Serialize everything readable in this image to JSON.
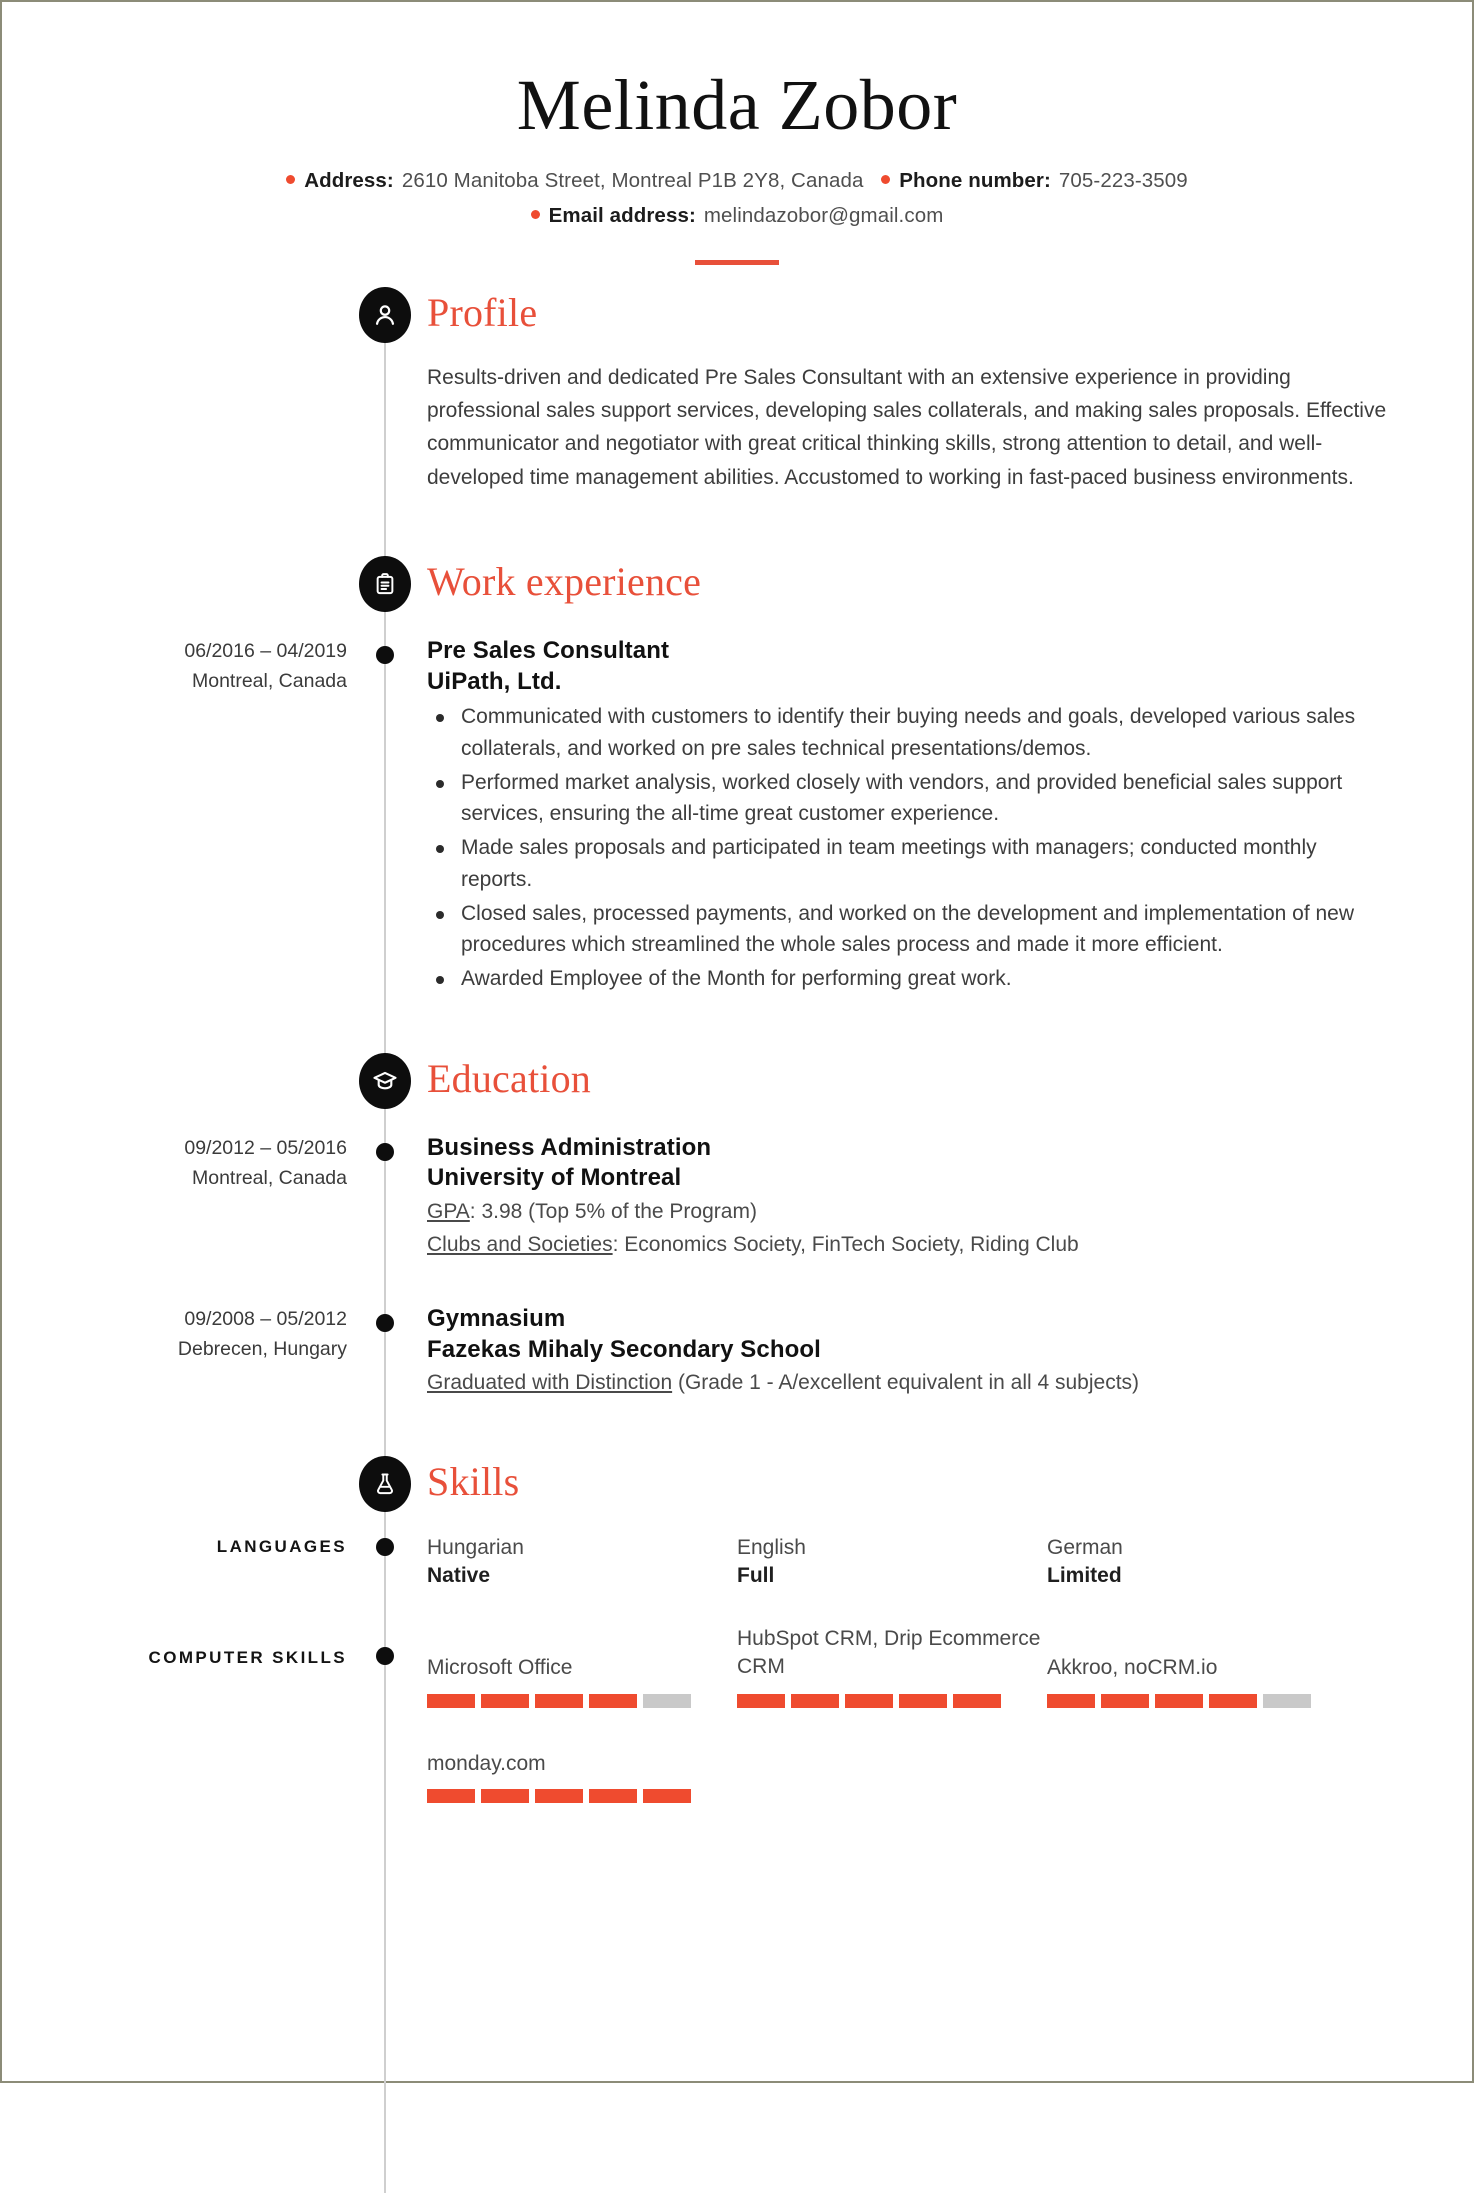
{
  "header": {
    "full_name": "Melinda Zobor",
    "contacts": [
      {
        "label": "Address:",
        "value": "2610 Manitoba Street, Montreal P1B 2Y8, Canada"
      },
      {
        "label": "Phone number:",
        "value": "705-223-3509"
      },
      {
        "label": "Email address:",
        "value": "melindazobor@gmail.com"
      }
    ]
  },
  "colors": {
    "accent": "#e8503a",
    "bar_filled": "#ef4b2f",
    "bar_empty": "#c9c9c9",
    "icon_circle": "#0d0d0d",
    "timeline": "#cfcfcf",
    "page_border": "#8c8c78"
  },
  "sections": {
    "profile": {
      "title": "Profile",
      "icon": "person-icon",
      "text": "Results-driven and dedicated Pre Sales Consultant with an extensive experience in providing professional sales support services, developing sales collaterals, and making sales proposals. Effective communicator and negotiator with great critical thinking skills, strong attention to detail, and well-developed time management abilities. Accustomed to working in fast-paced business environments."
    },
    "work": {
      "title": "Work experience",
      "icon": "briefcase-icon",
      "entries": [
        {
          "dates": "06/2016 – 04/2019",
          "location": "Montreal, Canada",
          "position": "Pre Sales Consultant",
          "company": "UiPath, Ltd.",
          "bullets": [
            "Communicated with customers to identify their buying needs and goals, developed various sales collaterals, and worked on pre sales technical presentations/demos.",
            "Performed market analysis, worked closely with vendors, and provided beneficial sales support services, ensuring the all-time great customer experience.",
            "Made sales proposals and participated in team meetings with managers; conducted monthly reports.",
            "Closed sales, processed payments, and worked on the development and implementation of new procedures which streamlined the whole sales process and made it more efficient.",
            "Awarded Employee of the Month for performing great work."
          ]
        }
      ]
    },
    "education": {
      "title": "Education",
      "icon": "graduation-cap-icon",
      "entries": [
        {
          "dates": "09/2012 – 05/2016",
          "location": "Montreal, Canada",
          "degree": "Business Administration",
          "school": "University of Montreal",
          "notes": [
            {
              "label": "GPA",
              "value": ": 3.98 (Top 5% of the Program)"
            },
            {
              "label": "Clubs and Societies",
              "value": ": Economics Society, FinTech Society, Riding Club"
            }
          ]
        },
        {
          "dates": "09/2008 – 05/2012",
          "location": "Debrecen, Hungary",
          "degree": "Gymnasium",
          "school": "Fazekas Mihaly Secondary School",
          "notes": [
            {
              "label": "Graduated with Distinction",
              "value": " (Grade 1 - A/excellent equivalent in all 4 subjects)"
            }
          ]
        }
      ]
    },
    "skills": {
      "title": "Skills",
      "icon": "flask-icon",
      "languages": {
        "label": "LANGUAGES",
        "items": [
          {
            "name": "Hungarian",
            "level": "Native"
          },
          {
            "name": "English",
            "level": "Full"
          },
          {
            "name": "German",
            "level": "Limited"
          }
        ]
      },
      "computer": {
        "label": "COMPUTER SKILLS",
        "max_segments": 5,
        "items": [
          {
            "name": "Microsoft Office",
            "rating": 4
          },
          {
            "name": "HubSpot CRM, Drip Ecommerce CRM",
            "rating": 5
          },
          {
            "name": "Akkroo, noCRM.io",
            "rating": 4
          },
          {
            "name": "monday.com",
            "rating": 5
          }
        ]
      }
    }
  }
}
